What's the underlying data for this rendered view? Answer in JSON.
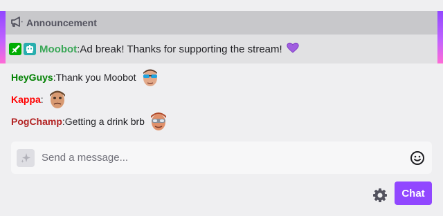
{
  "announcement": {
    "header_label": "Announcement",
    "author": "Moobot",
    "separator": ":",
    "message": " Ad break! Thanks for supporting the stream!",
    "badges": [
      "moderator-sword-icon",
      "bot-icon"
    ],
    "emoji": "purple-heart-icon"
  },
  "chat": {
    "messages": [
      {
        "user": "HeyGuys",
        "separator": ":",
        "text": " Thank you Moobot",
        "user_color": "#008000",
        "emote": "face-emote-sunglasses"
      },
      {
        "user": "Kappa",
        "separator": ":",
        "text": "",
        "user_color": "#ff0000",
        "emote": "face-emote-kappa"
      },
      {
        "user": "PogChamp",
        "separator": ":",
        "text": " Getting a drink brb",
        "user_color": "#b22222",
        "emote": "face-emote-goggles"
      }
    ]
  },
  "input": {
    "placeholder": "Send a message..."
  },
  "controls": {
    "chat_button_label": "Chat"
  },
  "colors": {
    "accent": "#9147ff",
    "moobot": "#3aa757"
  }
}
